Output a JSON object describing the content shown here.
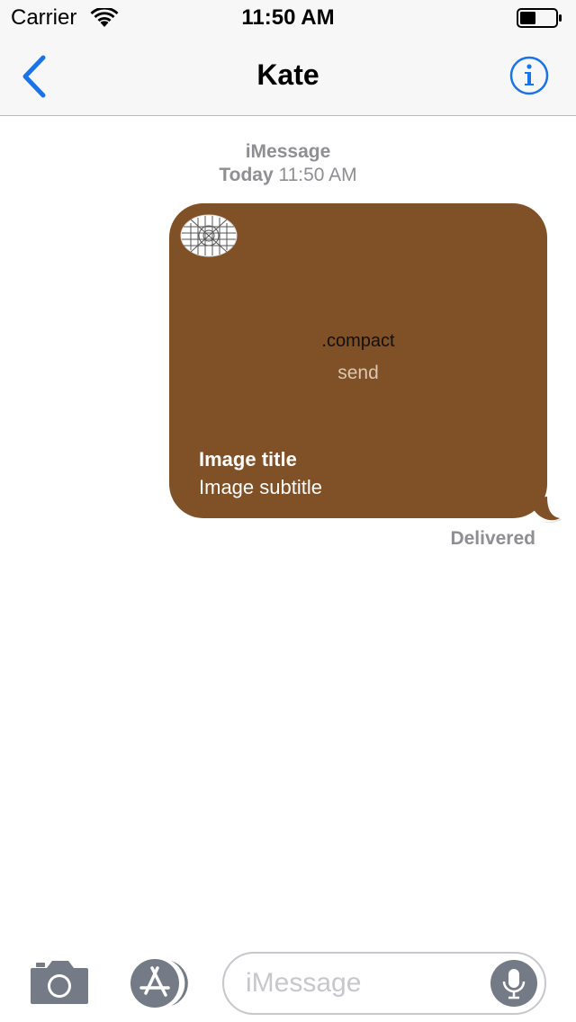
{
  "status_bar": {
    "carrier": "Carrier",
    "time": "11:50 AM"
  },
  "nav": {
    "title": "Kate",
    "back_icon": "chevron-left-icon",
    "info_icon": "info-icon"
  },
  "conversation": {
    "service": "iMessage",
    "date_label": "Today",
    "time": "11:50 AM"
  },
  "message": {
    "caption": ".compact",
    "subcaption": "send",
    "image_title": "Image title",
    "image_subtitle": "Image subtitle",
    "bubble_color": "#805026",
    "status": "Delivered"
  },
  "input_bar": {
    "placeholder": "iMessage",
    "camera_icon": "camera-icon",
    "app_store_icon": "app-store-icon",
    "mic_icon": "microphone-icon"
  },
  "colors": {
    "accent": "#1a73e8",
    "secondary_text": "#8e8e93",
    "toolbar_icon": "#747a86"
  }
}
